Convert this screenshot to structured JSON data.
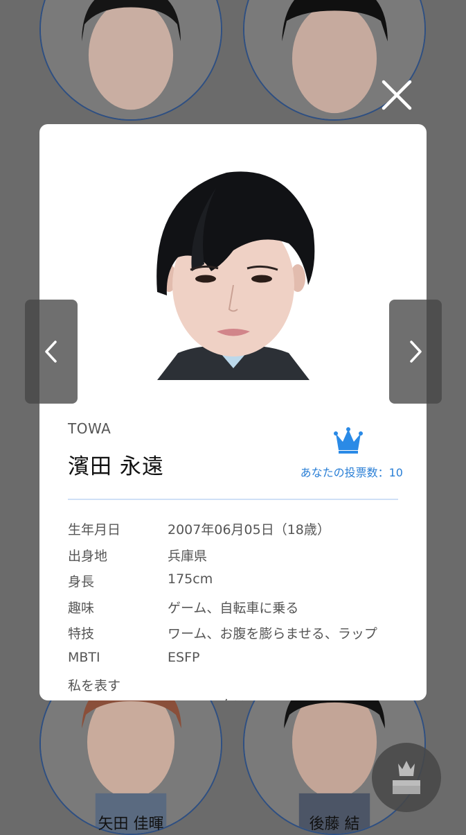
{
  "background": {
    "bottom_names": [
      "矢田 佳暉",
      "後藤 結"
    ]
  },
  "profile": {
    "romaji": "TOWA",
    "name": "濱田 永遠",
    "vote_count_text": "あなたの投票数：10",
    "details": [
      {
        "label": "生年月日",
        "value": "2007年06月05日（18歳）"
      },
      {
        "label": "出身地",
        "value": "兵庫県"
      },
      {
        "label": "身長",
        "value": "175cm"
      },
      {
        "label": "趣味",
        "value": "ゲーム、自転車に乗る"
      },
      {
        "label": "特技",
        "value": "ワーム、お腹を膨らませる、ラップ"
      },
      {
        "label": "MBTI",
        "value": "ESFP"
      },
      {
        "label": "私を表す",
        "value": "フェニックス"
      }
    ]
  },
  "icons": {
    "close": "close-icon",
    "prev": "chevron-left-icon",
    "next": "chevron-right-icon",
    "crown": "crown-icon",
    "vote_box": "vote-box-icon"
  },
  "colors": {
    "overlay": "#6b6b6b",
    "modal_bg": "#ffffff",
    "accent": "#2a7fd6",
    "crown": "#2a8ae6",
    "circle_border": "#2e4f82",
    "divider": "#cfe0f6"
  }
}
